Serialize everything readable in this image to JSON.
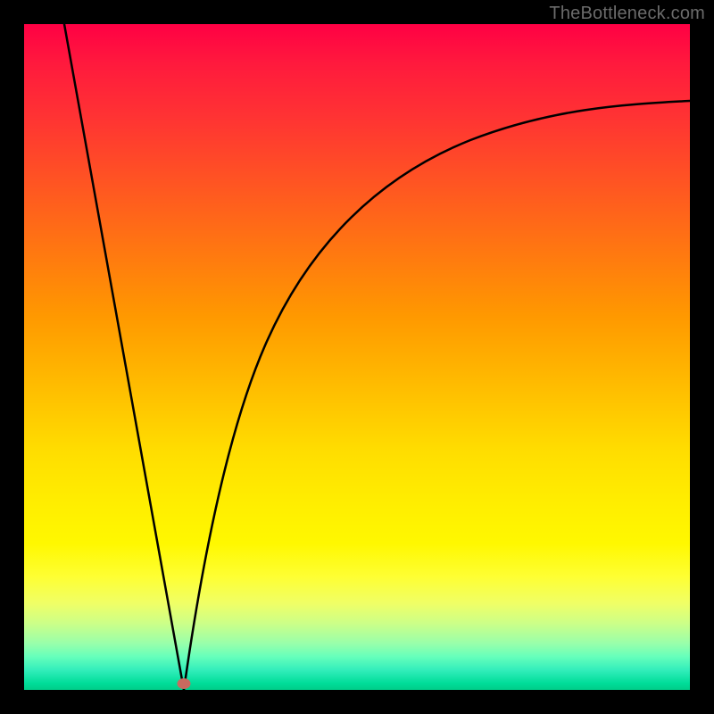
{
  "watermark": "TheBottleneck.com",
  "marker": {
    "x_pct": 24.0,
    "y_pct": 99.0
  },
  "chart_data": {
    "type": "line",
    "title": "",
    "xlabel": "",
    "ylabel": "",
    "xlim": [
      0,
      100
    ],
    "ylim": [
      0,
      100
    ],
    "background_gradient": [
      "#ff0044",
      "#ff9900",
      "#ffee00",
      "#00cc88"
    ],
    "series": [
      {
        "name": "left-branch",
        "x": [
          6,
          8,
          10,
          12,
          14,
          16,
          18,
          20,
          21,
          22,
          23,
          24
        ],
        "y": [
          100,
          89,
          78,
          67,
          56,
          45,
          34,
          22,
          16,
          10,
          5,
          0
        ]
      },
      {
        "name": "right-branch",
        "x": [
          24,
          25,
          26,
          27,
          28,
          30,
          32,
          34,
          36,
          40,
          45,
          50,
          55,
          60,
          65,
          70,
          75,
          80,
          85,
          90,
          95,
          100
        ],
        "y": [
          0,
          6,
          12,
          18,
          23,
          32,
          40,
          46,
          51,
          59,
          66,
          71,
          75,
          78,
          80,
          82,
          83.5,
          85,
          86,
          87,
          87.8,
          88.5
        ]
      }
    ],
    "annotations": [
      {
        "name": "minimum-marker",
        "x": 24,
        "y": 0,
        "color": "#c96a5f"
      }
    ]
  }
}
